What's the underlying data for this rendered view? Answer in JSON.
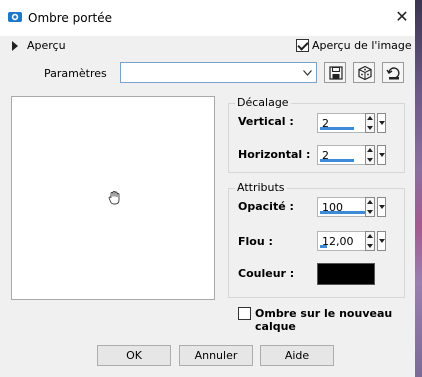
{
  "window": {
    "title": "Ombre portée",
    "close_glyph": "✕"
  },
  "header": {
    "apercu_label": "Aperçu",
    "apercu_image_label": "Aperçu de l'image",
    "apercu_image_checked": true
  },
  "params": {
    "label": "Paramètres",
    "selected_value": "",
    "dropdown_glyph": "⌄",
    "buttons": [
      "save-preset-icon",
      "random-dice-icon",
      "reset-icon"
    ]
  },
  "decalage": {
    "title": "Décalage",
    "vertical_label": "Vertical :",
    "vertical_value": "2",
    "horizontal_label": "Horizontal :",
    "horizontal_value": "2"
  },
  "attributs": {
    "title": "Attributs",
    "opacite_label": "Opacité :",
    "opacite_value": "100",
    "flou_label": "Flou :",
    "flou_value": "12,00",
    "couleur_label": "Couleur :",
    "couleur_hex": "#000000"
  },
  "options": {
    "nouveau_calque_label": "Ombre sur le nouveau calque",
    "nouveau_calque_checked": false
  },
  "footer": {
    "ok_label": "OK",
    "annuler_label": "Annuler",
    "aide_label": "Aide"
  },
  "colors": {
    "accent": "#3d8ad8",
    "dialog_bg": "#f0f0f0",
    "titlebar_bg": "#ffffff"
  }
}
